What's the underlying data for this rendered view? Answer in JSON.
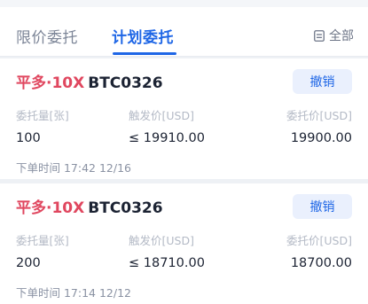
{
  "tabs": {
    "limit_orders": "限价委托",
    "plan_orders": "计划委托",
    "all_label": "全部"
  },
  "orders": [
    {
      "side": "平多·10X",
      "symbol": "BTC0326",
      "cancel_label": "撤销",
      "qty_label": "委托量[张]",
      "trigger_label": "触发价[USD]",
      "price_label": "委托价[USD]",
      "qty": "100",
      "trigger": "≤ 19910.00",
      "price": "19900.00",
      "time": "下单时间 17:42 12/16"
    },
    {
      "side": "平多·10X",
      "symbol": "BTC0326",
      "cancel_label": "撤销",
      "qty_label": "委托量[张]",
      "trigger_label": "触发价[USD]",
      "price_label": "委托价[USD]",
      "qty": "200",
      "trigger": "≤ 18710.00",
      "price": "18700.00",
      "time": "下单时间 17:14 12/12"
    }
  ],
  "colors": {
    "accent": "#1e66e6",
    "sell_red": "#e0475f",
    "background": "#eef1f5"
  }
}
